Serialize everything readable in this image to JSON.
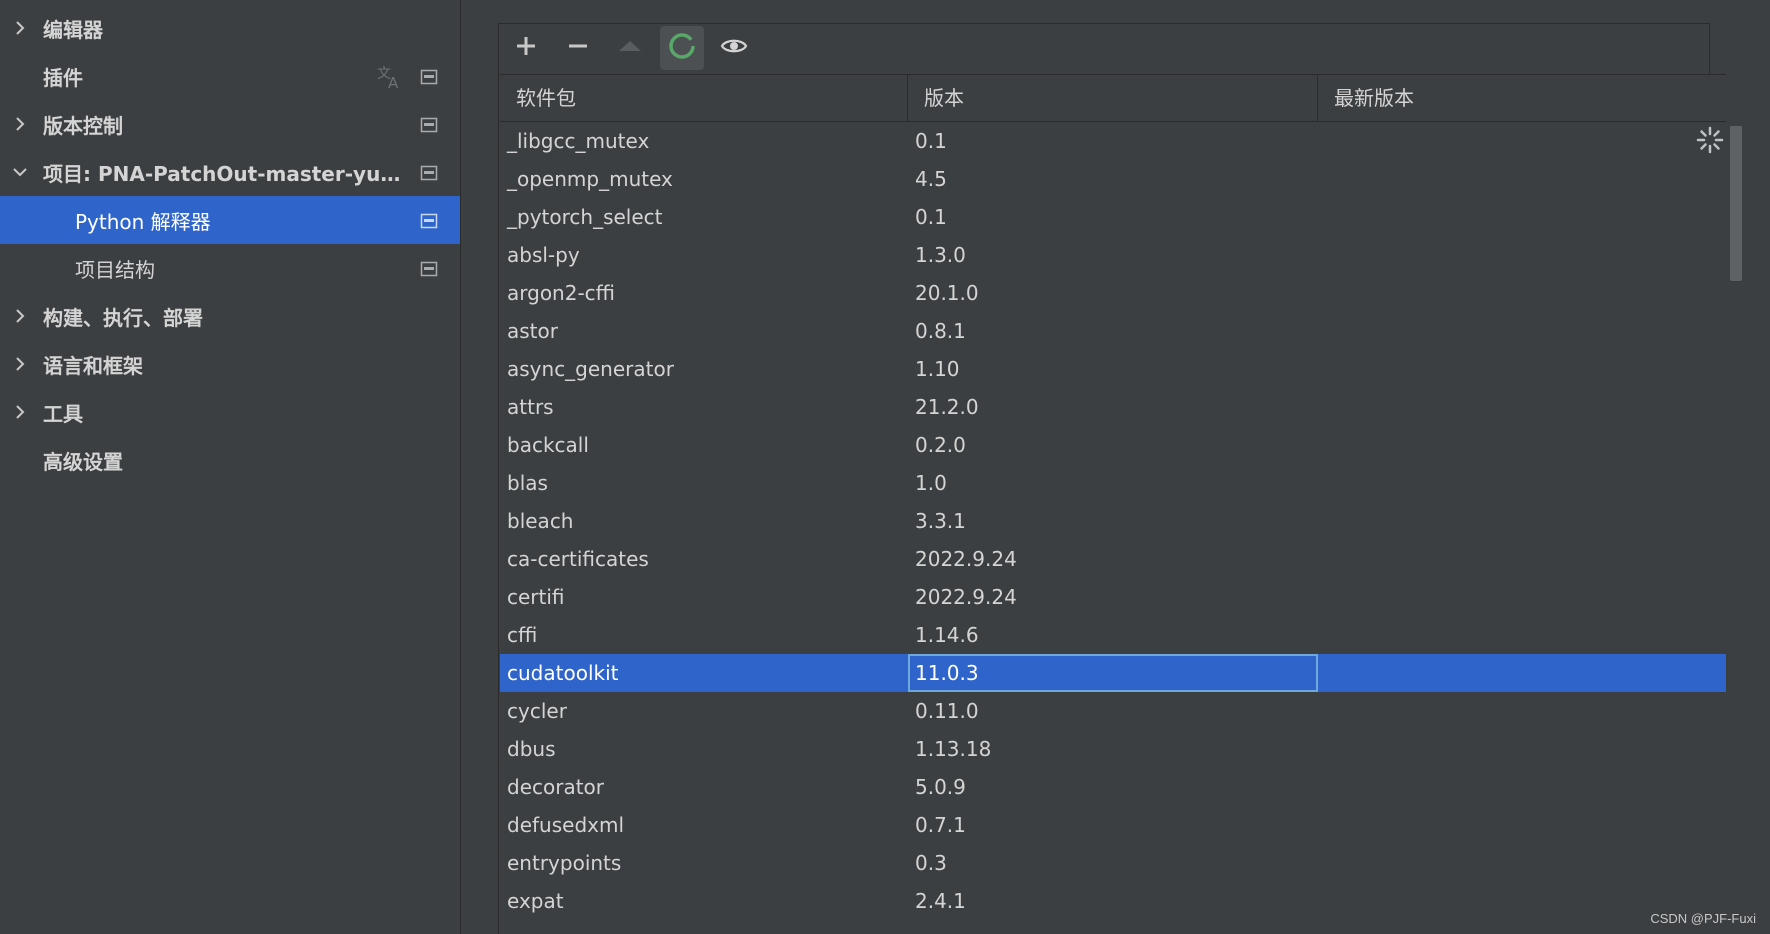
{
  "sidebar": {
    "items": [
      {
        "label": "编辑器"
      },
      {
        "label": "插件"
      },
      {
        "label": "版本控制"
      },
      {
        "label": "项目: PNA-PatchOut-master-yuansh..."
      },
      {
        "label": "Python 解释器"
      },
      {
        "label": "项目结构"
      },
      {
        "label": "构建、执行、部署"
      },
      {
        "label": "语言和框架"
      },
      {
        "label": "工具"
      },
      {
        "label": "高级设置"
      }
    ]
  },
  "toolbar": {
    "add_icon": "plus-icon",
    "remove_icon": "minus-icon",
    "upgrade_icon": "triangle-up-icon",
    "refresh_icon": "refresh-circle-icon",
    "show_icon": "eye-icon"
  },
  "table": {
    "columns": [
      "软件包",
      "版本",
      "最新版本"
    ],
    "rows": [
      {
        "name": "_libgcc_mutex",
        "version": "0.1",
        "latest": ""
      },
      {
        "name": "_openmp_mutex",
        "version": "4.5",
        "latest": ""
      },
      {
        "name": "_pytorch_select",
        "version": "0.1",
        "latest": ""
      },
      {
        "name": "absl-py",
        "version": "1.3.0",
        "latest": ""
      },
      {
        "name": "argon2-cffi",
        "version": "20.1.0",
        "latest": ""
      },
      {
        "name": "astor",
        "version": "0.8.1",
        "latest": ""
      },
      {
        "name": "async_generator",
        "version": "1.10",
        "latest": ""
      },
      {
        "name": "attrs",
        "version": "21.2.0",
        "latest": ""
      },
      {
        "name": "backcall",
        "version": "0.2.0",
        "latest": ""
      },
      {
        "name": "blas",
        "version": "1.0",
        "latest": ""
      },
      {
        "name": "bleach",
        "version": "3.3.1",
        "latest": ""
      },
      {
        "name": "ca-certificates",
        "version": "2022.9.24",
        "latest": ""
      },
      {
        "name": "certifi",
        "version": "2022.9.24",
        "latest": ""
      },
      {
        "name": "cffi",
        "version": "1.14.6",
        "latest": ""
      },
      {
        "name": "cudatoolkit",
        "version": "11.0.3",
        "latest": ""
      },
      {
        "name": "cycler",
        "version": "0.11.0",
        "latest": ""
      },
      {
        "name": "dbus",
        "version": "1.13.18",
        "latest": ""
      },
      {
        "name": "decorator",
        "version": "5.0.9",
        "latest": ""
      },
      {
        "name": "defusedxml",
        "version": "0.7.1",
        "latest": ""
      },
      {
        "name": "entrypoints",
        "version": "0.3",
        "latest": ""
      },
      {
        "name": "expat",
        "version": "2.4.1",
        "latest": ""
      }
    ]
  },
  "colors": {
    "background": "#3c3f41",
    "selection": "#2f65ca",
    "text": "#d4d4d4",
    "refresh_green": "#59a869"
  },
  "watermark": "CSDN @PJF-Fuxi"
}
